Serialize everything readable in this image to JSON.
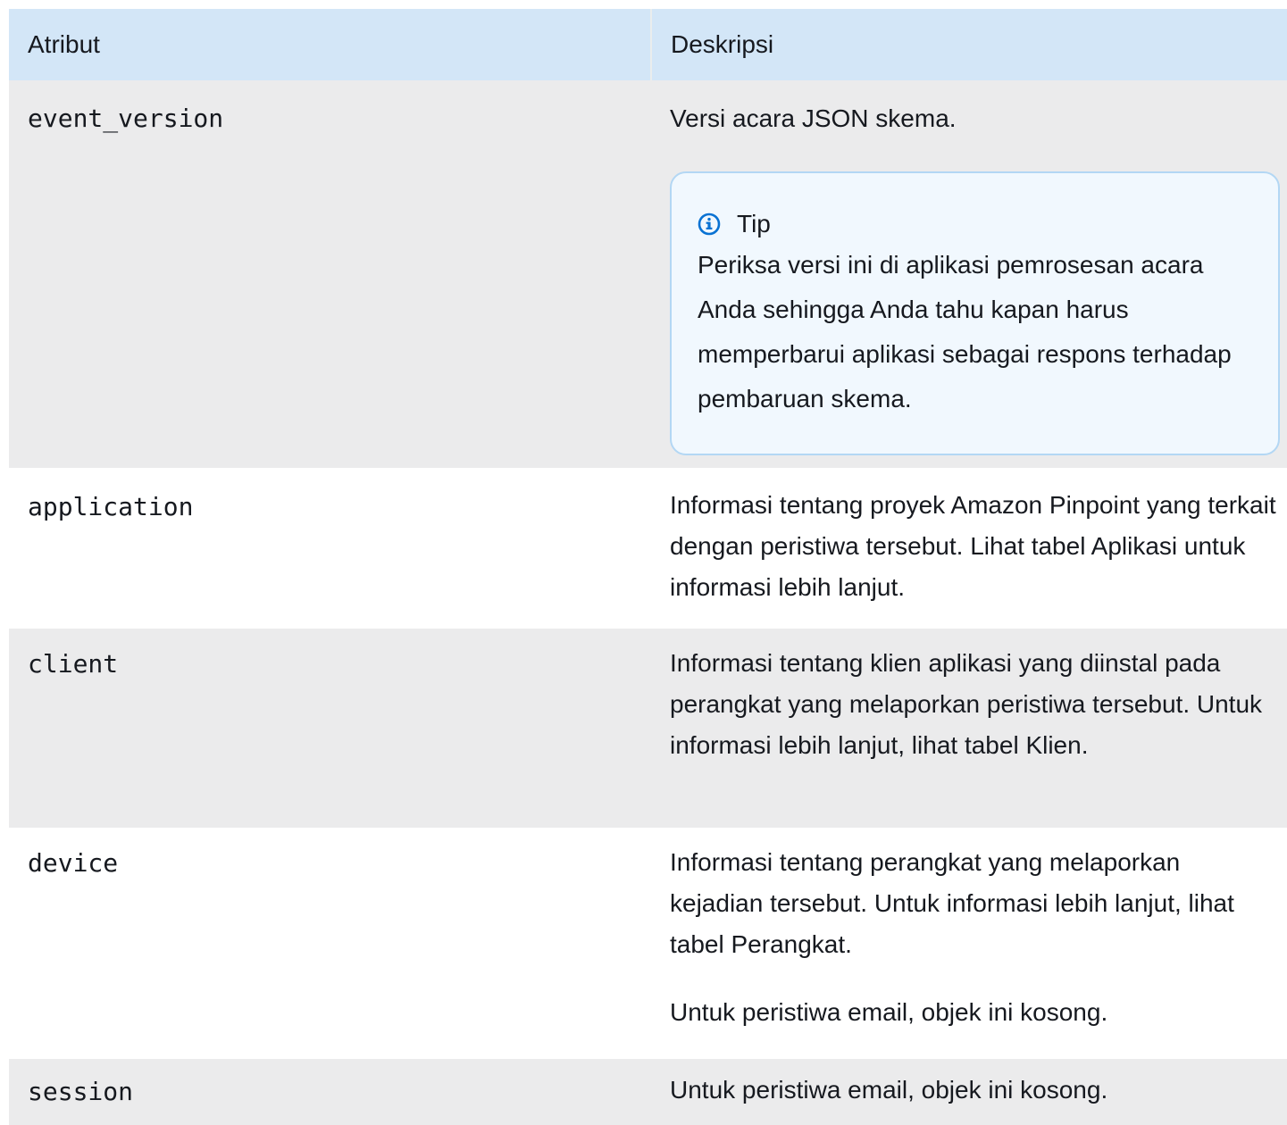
{
  "table": {
    "headers": {
      "attribute": "Atribut",
      "description": "Deskripsi"
    },
    "rows": [
      {
        "attribute": "event_version",
        "description": "Versi acara JSON skema.",
        "tip": {
          "icon": "info-icon",
          "title": "Tip",
          "text": "Periksa versi ini di aplikasi pemrosesan acara Anda sehingga Anda tahu kapan harus memperbarui aplikasi sebagai respons terhadap pembaruan skema."
        }
      },
      {
        "attribute": "application",
        "description": "Informasi tentang proyek Amazon Pinpoint yang terkait dengan peristiwa tersebut. Lihat tabel Aplikasi untuk informasi lebih lanjut."
      },
      {
        "attribute": "client",
        "description": "Informasi tentang klien aplikasi yang diinstal pada perangkat yang melaporkan peristiwa tersebut. Untuk informasi lebih lanjut, lihat tabel Klien."
      },
      {
        "attribute": "device",
        "description": "Informasi tentang perangkat yang melaporkan kejadian tersebut. Untuk informasi lebih lanjut, lihat tabel Perangkat.",
        "note": "Untuk peristiwa email, objek ini kosong."
      },
      {
        "attribute": "session",
        "description": "Untuk peristiwa email, objek ini kosong."
      }
    ]
  },
  "colors": {
    "header_bg": "#d3e6f7",
    "alt_row_bg": "#ebebec",
    "tip_border": "#b3d7f4",
    "tip_bg": "#f1f8fe",
    "info_icon": "#0972d3"
  }
}
